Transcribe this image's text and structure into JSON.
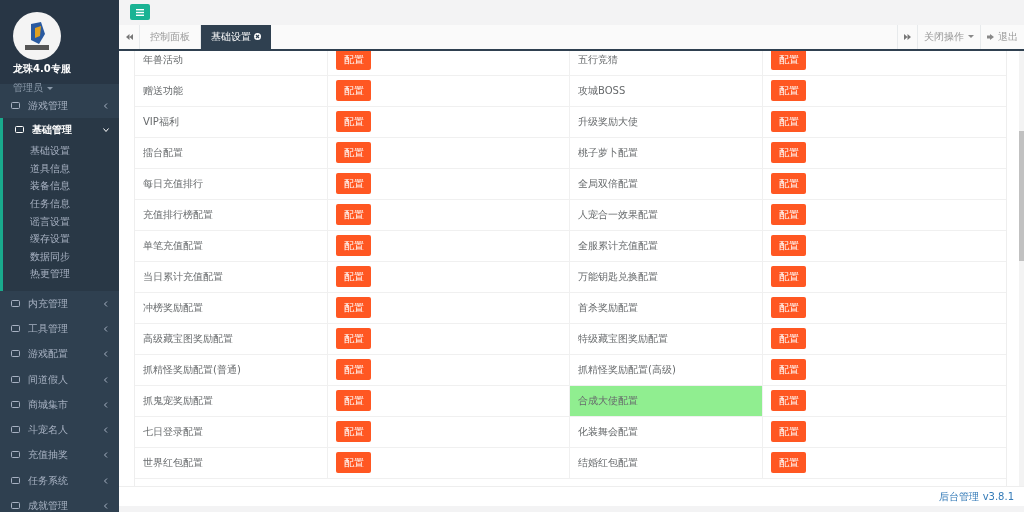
{
  "sidebar": {
    "profile": {
      "name": "龙珠4.0专服",
      "role": "管理员"
    },
    "items": [
      {
        "label": "游戏管理",
        "expanded": false
      },
      {
        "label": "基础管理",
        "expanded": true,
        "children": [
          {
            "label": "基础设置"
          },
          {
            "label": "道具信息"
          },
          {
            "label": "装备信息"
          },
          {
            "label": "任务信息"
          },
          {
            "label": "谣言设置"
          },
          {
            "label": "缓存设置"
          },
          {
            "label": "数据同步"
          },
          {
            "label": "热更管理"
          }
        ]
      },
      {
        "label": "内充管理",
        "expanded": false
      },
      {
        "label": "工具管理",
        "expanded": false
      },
      {
        "label": "游戏配置",
        "expanded": false
      },
      {
        "label": "间道假人",
        "expanded": false
      },
      {
        "label": "商城集市",
        "expanded": false
      },
      {
        "label": "斗宠名人",
        "expanded": false
      },
      {
        "label": "充值抽奖",
        "expanded": false
      },
      {
        "label": "任务系统",
        "expanded": false
      },
      {
        "label": "成就管理",
        "expanded": false
      }
    ]
  },
  "tabs": [
    {
      "label": "控制面板",
      "selected": false
    },
    {
      "label": "基础设置",
      "selected": true
    }
  ],
  "tab_actions": {
    "close_menu": "关闭操作",
    "logout": "退出"
  },
  "rows": [
    [
      {
        "label": "年兽活动",
        "button": "配置",
        "highlighted": false
      },
      {
        "label": "五行竞猜",
        "button": "配置",
        "highlighted": false
      }
    ],
    [
      {
        "label": "赠送功能",
        "button": "配置",
        "highlighted": false
      },
      {
        "label": "攻城BOSS",
        "button": "配置",
        "highlighted": false
      }
    ],
    [
      {
        "label": "VIP福利",
        "button": "配置",
        "highlighted": false
      },
      {
        "label": "升级奖励大使",
        "button": "配置",
        "highlighted": false
      }
    ],
    [
      {
        "label": "擂台配置",
        "button": "配置",
        "highlighted": false
      },
      {
        "label": "桃子萝卜配置",
        "button": "配置",
        "highlighted": false
      }
    ],
    [
      {
        "label": "每日充值排行",
        "button": "配置",
        "highlighted": false
      },
      {
        "label": "全局双倍配置",
        "button": "配置",
        "highlighted": false
      }
    ],
    [
      {
        "label": "充值排行榜配置",
        "button": "配置",
        "highlighted": false
      },
      {
        "label": "人宠合一效果配置",
        "button": "配置",
        "highlighted": false
      }
    ],
    [
      {
        "label": "单笔充值配置",
        "button": "配置",
        "highlighted": false
      },
      {
        "label": "全服累计充值配置",
        "button": "配置",
        "highlighted": false
      }
    ],
    [
      {
        "label": "当日累计充值配置",
        "button": "配置",
        "highlighted": false
      },
      {
        "label": "万能钥匙兑换配置",
        "button": "配置",
        "highlighted": false
      }
    ],
    [
      {
        "label": "冲榜奖励配置",
        "button": "配置",
        "highlighted": false
      },
      {
        "label": "首杀奖励配置",
        "button": "配置",
        "highlighted": false
      }
    ],
    [
      {
        "label": "高级藏宝图奖励配置",
        "button": "配置",
        "highlighted": false
      },
      {
        "label": "特级藏宝图奖励配置",
        "button": "配置",
        "highlighted": false
      }
    ],
    [
      {
        "label": "抓精怪奖励配置(普通)",
        "button": "配置",
        "highlighted": false
      },
      {
        "label": "抓精怪奖励配置(高级)",
        "button": "配置",
        "highlighted": false
      }
    ],
    [
      {
        "label": "抓鬼宠奖励配置",
        "button": "配置",
        "highlighted": false
      },
      {
        "label": "合成大使配置",
        "button": "配置",
        "highlighted": true
      }
    ],
    [
      {
        "label": "七日登录配置",
        "button": "配置",
        "highlighted": false
      },
      {
        "label": "化装舞会配置",
        "button": "配置",
        "highlighted": false
      }
    ],
    [
      {
        "label": "世界红包配置",
        "button": "配置",
        "highlighted": false
      },
      {
        "label": "结婚红包配置",
        "button": "配置",
        "highlighted": false
      }
    ]
  ],
  "footer": {
    "app": "后台管理",
    "version": "v3.8.1"
  }
}
